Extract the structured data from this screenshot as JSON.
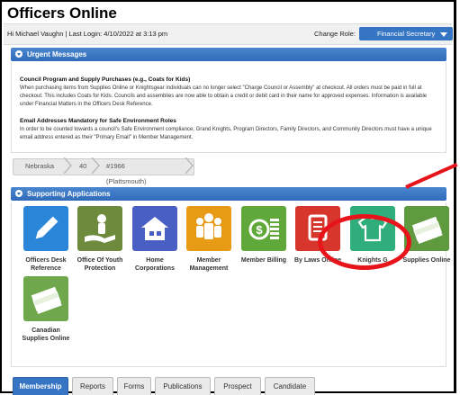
{
  "page": {
    "title": "Officers Online"
  },
  "user_bar": {
    "user_line": "Hi Michael Vaughn  |  Last Login: 4/10/2022 at 3:13 pm",
    "change_role_label": "Change Role:",
    "role_selected": "Financial Secretary"
  },
  "urgent": {
    "header": "Urgent Messages",
    "messages": [
      {
        "title": "Council Program and Supply Purchases (e.g., Coats for Kids)",
        "body": "When purchasing items from Supplies Online or Knightsgear individuals can no longer select \"Charge Council or Assembly\" at checkout. All orders must be paid in full at checkout. This includes Coats for Kids.  Councils and assemblies are now able to obtain a credit or debit card in their name for approved expenses. Information is available under Financial Matters in the Officers Desk Reference."
      },
      {
        "title": "Email Addresses Mandatory for Safe Environment Roles",
        "body": "In order to be counted towards a council's Safe Environment compliance, Grand Knights, Program Directors, Family Directors, and Community Directors must have a unique email address entered as their \"Primary Email\" in Member Management."
      }
    ]
  },
  "breadcrumb": [
    "Nebraska",
    "40",
    "#1966 (Plattsmouth)"
  ],
  "apps": {
    "header": "Supporting Applications",
    "items": [
      {
        "label": "Officers Desk Reference",
        "icon": "pencil-icon",
        "color": "#2b86d9"
      },
      {
        "label": "Office Of Youth Protection",
        "icon": "youth-protection-icon",
        "color": "#6e8b3d"
      },
      {
        "label": "Home Corporations",
        "icon": "house-icon",
        "color": "#4a5fc4"
      },
      {
        "label": "Member Management",
        "icon": "people-icon",
        "color": "#e79a16"
      },
      {
        "label": "Member Billing",
        "icon": "coins-icon",
        "color": "#5fa839"
      },
      {
        "label": "By Laws Online",
        "icon": "document-icon",
        "color": "#d6362b"
      },
      {
        "label": "Knights Gear",
        "icon": "tshirt-icon",
        "color": "#2fad7a"
      },
      {
        "label": "Supplies Online",
        "icon": "money-stack-icon",
        "color": "#5f9a3e"
      },
      {
        "label": "Canadian Supplies Online",
        "icon": "money-stack-icon",
        "color": "#6fa84c"
      }
    ]
  },
  "knights_gear_visible_label": "Knights G",
  "tabs": [
    "Membership",
    "Reports",
    "Forms",
    "Publications",
    "Prospect",
    "Candidate"
  ],
  "colors": {
    "accent": "#3575c4",
    "annotation": "#e8141b"
  }
}
